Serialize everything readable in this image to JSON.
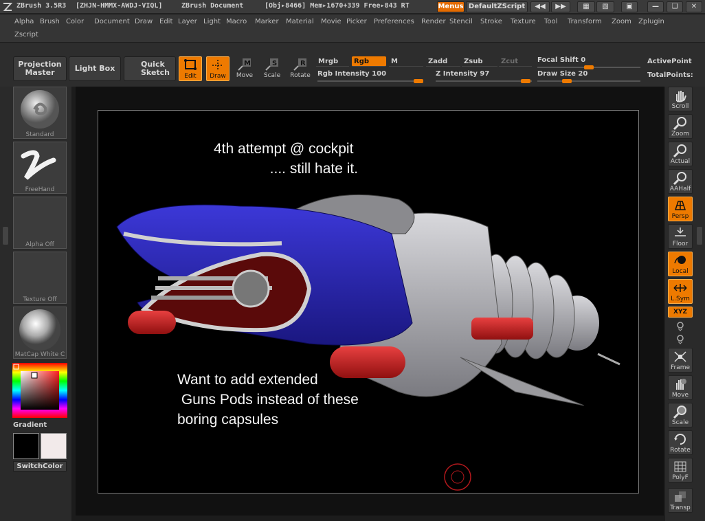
{
  "titlebar": {
    "app": "ZBrush 3.5R3",
    "serial": "[ZHJN-HMMX-AWDJ-VIQL]",
    "doc": "ZBrush Document",
    "stats": "[Obj▸8466] Mem▸1670+339 Free▸843 RT",
    "menus_label": "Menus",
    "script_label": "DefaultZScript"
  },
  "menu": [
    "Alpha",
    "Brush",
    "Color",
    "Document",
    "Draw",
    "Edit",
    "Layer",
    "Light",
    "Macro",
    "Marker",
    "Material",
    "Movie",
    "Picker",
    "Preferences",
    "Render",
    "Stencil",
    "Stroke",
    "Texture",
    "Tool",
    "Transform",
    "Zoom",
    "Zplugin",
    "Zscript"
  ],
  "toolbar": {
    "projection_master": "Projection Master",
    "light_box": "Light Box",
    "quick_sketch": "Quick Sketch",
    "edit": "Edit",
    "draw": "Draw",
    "move": "Move",
    "scale": "Scale",
    "rotate": "Rotate",
    "mrgb": "Mrgb",
    "rgb": "Rgb",
    "m": "M",
    "zadd": "Zadd",
    "zsub": "Zsub",
    "zcut": "Zcut",
    "rgb_intensity": "Rgb Intensity 100",
    "z_intensity": "Z Intensity 97",
    "focal_shift": "Focal Shift 0",
    "draw_size": "Draw Size 20",
    "active_points": "ActivePoint",
    "total_points": "TotalPoints:"
  },
  "left": {
    "brush": "Standard",
    "stroke": "FreeHand",
    "alpha": "Alpha Off",
    "texture": "Texture Off",
    "material": "MatCap White C",
    "gradient": "Gradient",
    "switch_color": "SwitchColor"
  },
  "right": [
    "Scroll",
    "Zoom",
    "Actual",
    "AAHalf",
    "Persp",
    "Floor",
    "Local",
    "L.Sym",
    "XYZ",
    "Frame",
    "Move",
    "Scale",
    "Rotate",
    "PolyF",
    "Transp"
  ],
  "canvas": {
    "note_top": "4th attempt @ cockpit\n              .... still hate it.",
    "note_bottom": "Want to add extended\n Guns Pods instead of these\nboring capsules"
  },
  "colors": {
    "accent": "#ee7a00",
    "primary": "#000000",
    "secondary": "#f2eaea"
  }
}
